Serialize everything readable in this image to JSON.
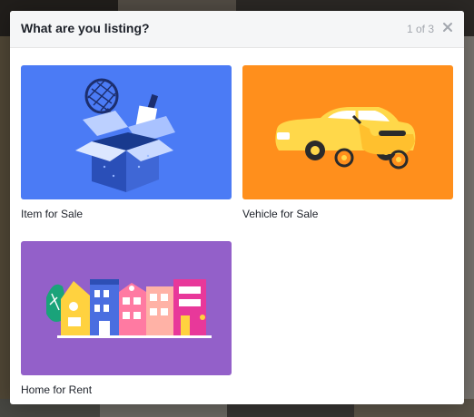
{
  "dialog": {
    "title": "What are you listing?",
    "step_counter": "1 of 3",
    "close_icon": "close-icon"
  },
  "options": [
    {
      "label": "Item for Sale",
      "background": "#4b7bf5",
      "icon": "open-box-icon"
    },
    {
      "label": "Vehicle for Sale",
      "background": "#ff8f1c",
      "icon": "car-and-scooter-icon"
    },
    {
      "label": "Home for Rent",
      "background": "#9360c9",
      "icon": "row-houses-icon"
    }
  ],
  "colors": {
    "header_bg": "#f5f6f7",
    "title_text": "#1d2129",
    "muted_text": "#a3a7ae"
  }
}
